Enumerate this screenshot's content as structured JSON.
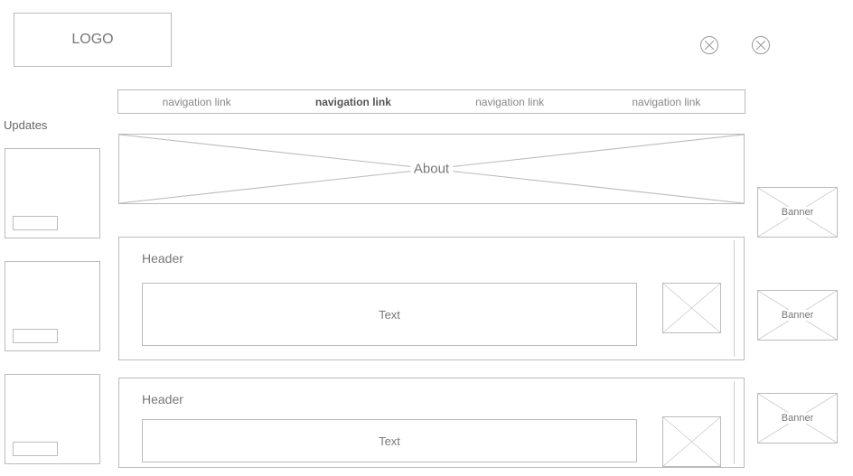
{
  "logo": {
    "text": "LOGO"
  },
  "nav": {
    "items": [
      {
        "label": "navigation link",
        "active": false
      },
      {
        "label": "navigation link",
        "active": true
      },
      {
        "label": "navigation link",
        "active": false
      },
      {
        "label": "navigation link",
        "active": false
      }
    ]
  },
  "sidebar": {
    "title": "Updates"
  },
  "hero": {
    "label": "About"
  },
  "cards": [
    {
      "header": "Header",
      "text": "Text"
    },
    {
      "header": "Header",
      "text": "Text"
    }
  ],
  "banners": [
    {
      "label": "Banner"
    },
    {
      "label": "Banner"
    },
    {
      "label": "Banner"
    }
  ]
}
